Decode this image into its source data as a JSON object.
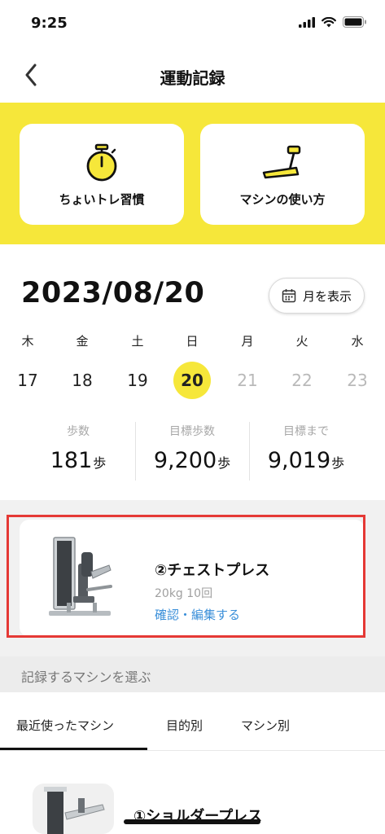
{
  "status": {
    "time": "9:25"
  },
  "nav": {
    "title": "運動記録"
  },
  "cards": {
    "left_label": "ちょいトレ習慣",
    "right_label": "マシンの使い方"
  },
  "date": {
    "title": "2023/08/20",
    "month_button": "月を表示"
  },
  "week": [
    {
      "dow": "木",
      "num": "17",
      "state": "past"
    },
    {
      "dow": "金",
      "num": "18",
      "state": "past"
    },
    {
      "dow": "土",
      "num": "19",
      "state": "past"
    },
    {
      "dow": "日",
      "num": "20",
      "state": "selected"
    },
    {
      "dow": "月",
      "num": "21",
      "state": "future"
    },
    {
      "dow": "火",
      "num": "22",
      "state": "future"
    },
    {
      "dow": "水",
      "num": "23",
      "state": "future"
    }
  ],
  "stats": [
    {
      "label": "歩数",
      "value": "181",
      "unit": "歩"
    },
    {
      "label": "目標歩数",
      "value": "9,200",
      "unit": "歩"
    },
    {
      "label": "目標まで",
      "value": "9,019",
      "unit": "歩"
    }
  ],
  "record": {
    "title": "②チェストプレス",
    "detail": "20kg 10回",
    "link": "確認・編集する"
  },
  "section": {
    "header": "記録するマシンを選ぶ"
  },
  "tabs": {
    "recent": "最近使ったマシン",
    "purpose": "目的別",
    "machine": "マシン別"
  },
  "list": {
    "first_title": "①ショルダープレス"
  },
  "colors": {
    "accent_yellow": "#f6e73a",
    "link_blue": "#3a8fd9",
    "highlight_red": "#e53935"
  }
}
